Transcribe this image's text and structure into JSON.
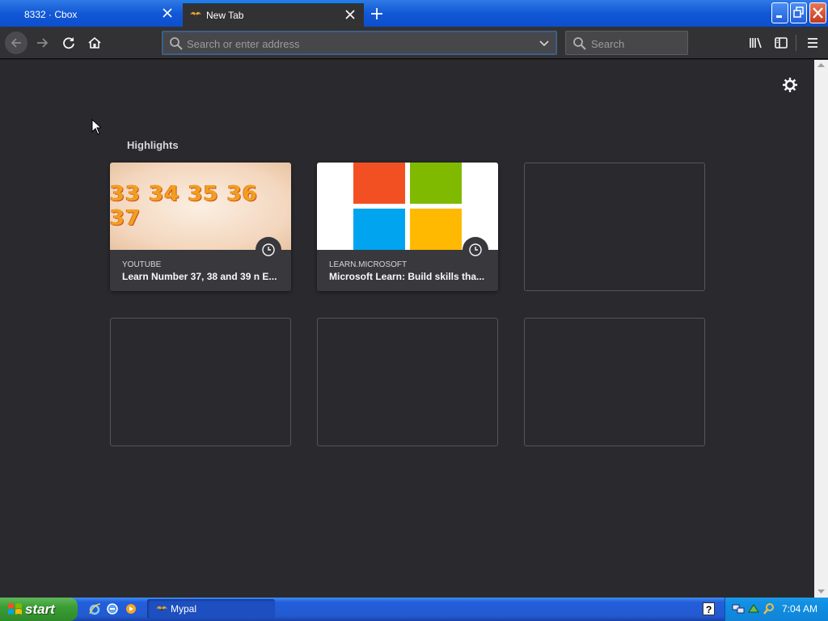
{
  "tabs": [
    {
      "label": "8332 · Cbox",
      "active": false
    },
    {
      "label": "New Tab",
      "active": true
    }
  ],
  "toolbar": {
    "url_placeholder": "Search or enter address",
    "search_placeholder": "Search"
  },
  "newtab": {
    "section_title": "Highlights",
    "cards": [
      {
        "source": "YOUTUBE",
        "title": "Learn Number 37, 38 and 39 n E...",
        "thumb_text": "33 34 35 36 37"
      },
      {
        "source": "LEARN.MICROSOFT",
        "title": "Microsoft Learn: Build skills tha..."
      }
    ]
  },
  "taskbar": {
    "start_label": "start",
    "task_label": "Mypal",
    "clock": "7:04 AM"
  },
  "colors": {
    "accent": "#0a84ff",
    "ms_red": "#f25022",
    "ms_green": "#7fba00",
    "ms_blue": "#00a4ef",
    "ms_yellow": "#ffb900"
  }
}
